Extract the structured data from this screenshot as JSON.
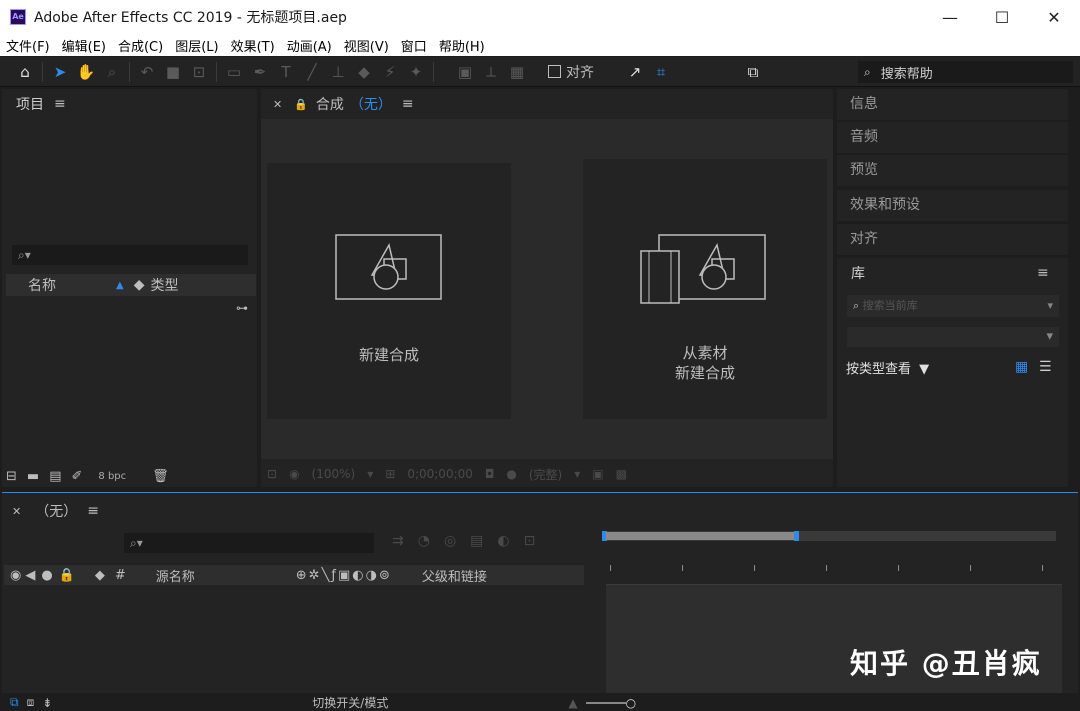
{
  "window": {
    "app_icon": "Ae",
    "title": "Adobe After Effects CC 2019 - 无标题项目.aep",
    "controls": [
      "—",
      "☐",
      "✕"
    ]
  },
  "menu": [
    "文件(F)",
    "编辑(E)",
    "合成(C)",
    "图层(L)",
    "效果(T)",
    "动画(A)",
    "视图(V)",
    "窗口",
    "帮助(H)"
  ],
  "toolbar": {
    "align_label": "对齐",
    "search_help": "搜索帮助"
  },
  "project": {
    "title": "项目",
    "col_name": "名称",
    "col_type": "类型",
    "bpc": "8 bpc"
  },
  "composition": {
    "title": "合成",
    "comp_name": "（无）",
    "new_comp": "新建合成",
    "from_footage_line1": "从素材",
    "from_footage_line2": "新建合成",
    "zoom": "(100%)",
    "timecode": "0;00;00;00",
    "resolution": "(完整)"
  },
  "right_panels": {
    "info": "信息",
    "audio": "音频",
    "preview": "预览",
    "effects": "效果和预设",
    "align": "对齐",
    "library": "库",
    "lib_search_placeholder": "搜索当前库",
    "view_by_type": "按类型查看"
  },
  "timeline": {
    "comp_name": "（无）",
    "col_source": "源名称",
    "col_parent": "父级和链接",
    "footer_toggle": "切换开关/模式"
  },
  "watermark": "知乎 @丑肖疯"
}
